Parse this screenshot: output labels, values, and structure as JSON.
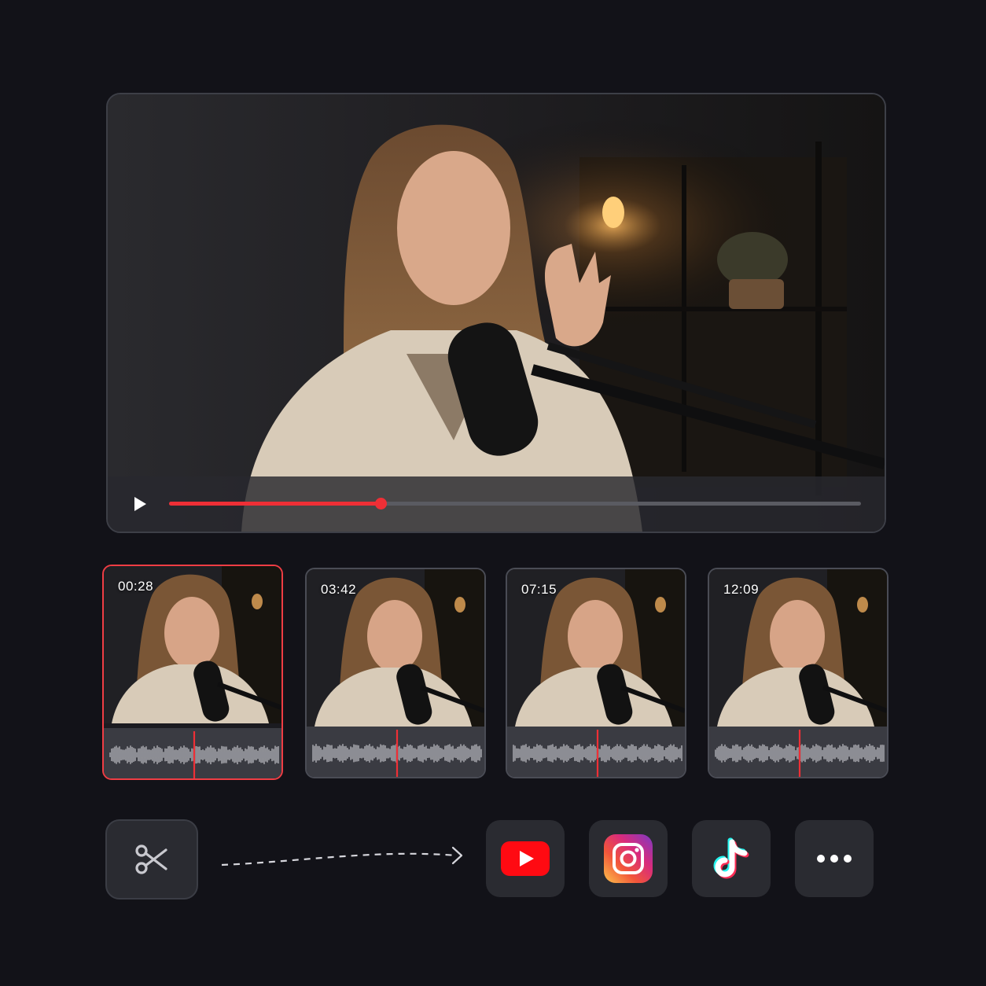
{
  "player": {
    "progress_fraction": 0.306,
    "accent_color": "#ee2f36"
  },
  "clips": [
    {
      "timestamp": "00:28",
      "selected": true
    },
    {
      "timestamp": "03:42",
      "selected": false
    },
    {
      "timestamp": "07:15",
      "selected": false
    },
    {
      "timestamp": "12:09",
      "selected": false
    }
  ],
  "share_targets": [
    {
      "icon": "youtube-icon"
    },
    {
      "icon": "instagram-icon"
    },
    {
      "icon": "tiktok-icon"
    },
    {
      "icon": "more-icon"
    }
  ],
  "tools": {
    "cut_icon": "scissors-icon",
    "flow_icon": "dashed-arrow-icon"
  },
  "colors": {
    "background": "#121218",
    "tile": "#2a2b31",
    "selected_border": "#ef3d44"
  }
}
